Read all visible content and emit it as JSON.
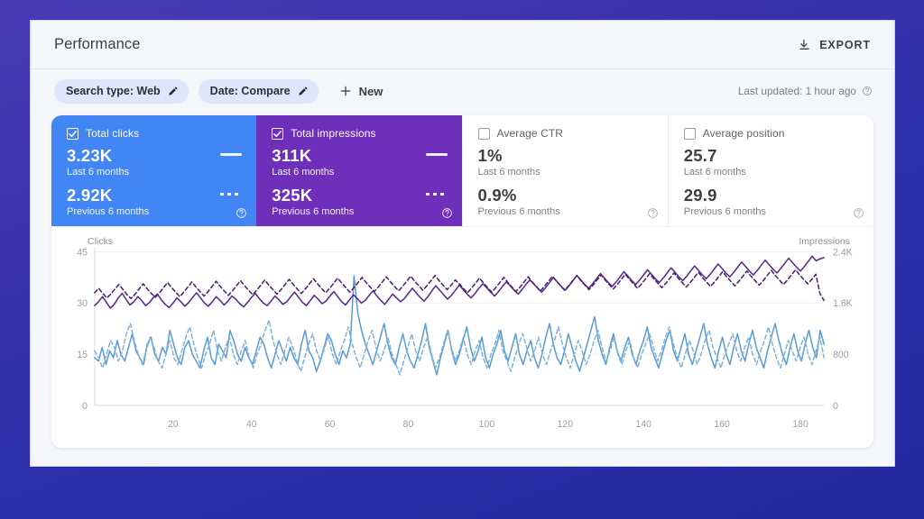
{
  "window": {
    "title": "Performance"
  },
  "topbar": {
    "title": "Performance",
    "export_label": "EXPORT",
    "export_icon": "download-icon"
  },
  "filterbar": {
    "chips": [
      {
        "label": "Search type: Web",
        "icon": "pencil-icon"
      },
      {
        "label": "Date: Compare",
        "icon": "pencil-icon"
      }
    ],
    "new_label": "New",
    "new_icon": "plus-icon",
    "last_updated": "Last updated: 1 hour ago",
    "help_icon": "help-circle-icon"
  },
  "metrics": [
    {
      "id": "total-clicks",
      "title": "Total clicks",
      "checked": true,
      "state": "active",
      "color": "#4285f4",
      "current_value": "3.23K",
      "current_period": "Last 6 months",
      "previous_value": "2.92K",
      "previous_period": "Previous 6 months",
      "current_mark": "solid",
      "previous_mark": "dashed",
      "help_icon": "help-circle-icon"
    },
    {
      "id": "total-impressions",
      "title": "Total impressions",
      "checked": true,
      "state": "active",
      "color": "#6e30ba",
      "current_value": "311K",
      "current_period": "Last 6 months",
      "previous_value": "325K",
      "previous_period": "Previous 6 months",
      "current_mark": "solid",
      "previous_mark": "dashed",
      "help_icon": "help-circle-icon"
    },
    {
      "id": "average-ctr",
      "title": "Average CTR",
      "checked": false,
      "state": "idle",
      "current_value": "1%",
      "current_period": "Last 6 months",
      "previous_value": "0.9%",
      "previous_period": "Previous 6 months",
      "help_icon": "help-circle-icon"
    },
    {
      "id": "average-position",
      "title": "Average position",
      "checked": false,
      "state": "idle",
      "current_value": "25.7",
      "current_period": "Last 6 months",
      "previous_value": "29.9",
      "previous_period": "Previous 6 months",
      "help_icon": "help-circle-icon"
    }
  ],
  "chart_data": {
    "type": "line",
    "title": "",
    "xlabel": "",
    "ylabel": "Clicks",
    "y2label": "Impressions",
    "grid": true,
    "legend_position": "metric-cards",
    "xlim": [
      0,
      186
    ],
    "xticks": [
      20,
      40,
      60,
      80,
      100,
      120,
      140,
      160,
      180
    ],
    "ylim": [
      0,
      45
    ],
    "yticks": [
      0,
      15,
      30,
      45
    ],
    "yticklabels": [
      "0",
      "15",
      "30",
      "45"
    ],
    "y2lim": [
      0,
      2400
    ],
    "y2ticks": [
      0,
      800,
      1600,
      2400
    ],
    "y2ticklabels": [
      "0",
      "800",
      "1.6K",
      "2.4K"
    ],
    "series": [
      {
        "name": "Total clicks — Last 6 months",
        "axis": "left",
        "style": "solid",
        "color": "#5b9bd5",
        "values": [
          14,
          13,
          17,
          12,
          16,
          14,
          19,
          15,
          13,
          17,
          21,
          16,
          14,
          12,
          18,
          20,
          15,
          13,
          17,
          15,
          22,
          18,
          14,
          12,
          17,
          19,
          15,
          13,
          11,
          16,
          20,
          14,
          12,
          18,
          16,
          14,
          22,
          19,
          15,
          13,
          17,
          14,
          12,
          16,
          20,
          18,
          14,
          11,
          15,
          19,
          16,
          13,
          17,
          14,
          12,
          18,
          22,
          16,
          14,
          10,
          13,
          17,
          21,
          19,
          15,
          12,
          16,
          14,
          18,
          38,
          27,
          22,
          18,
          15,
          12,
          16,
          20,
          24,
          18,
          14,
          12,
          17,
          21,
          16,
          13,
          11,
          15,
          19,
          24,
          17,
          13,
          9,
          14,
          18,
          22,
          16,
          12,
          15,
          19,
          23,
          17,
          13,
          16,
          20,
          14,
          11,
          15,
          18,
          22,
          16,
          13,
          17,
          21,
          15,
          12,
          16,
          19,
          14,
          11,
          15,
          20,
          24,
          18,
          14,
          12,
          16,
          21,
          17,
          13,
          10,
          14,
          18,
          22,
          26,
          19,
          15,
          12,
          17,
          21,
          16,
          13,
          17,
          20,
          15,
          12,
          16,
          19,
          23,
          17,
          14,
          11,
          15,
          19,
          22,
          16,
          13,
          17,
          21,
          15,
          12,
          16,
          20,
          24,
          18,
          14,
          11,
          16,
          20,
          15,
          12,
          17,
          21,
          16,
          13,
          18,
          22,
          17,
          14,
          11,
          16,
          20,
          24,
          19,
          15,
          12,
          17,
          21,
          16,
          13,
          18,
          22,
          17,
          14,
          22,
          18
        ]
      },
      {
        "name": "Total clicks — Previous 6 months",
        "axis": "left",
        "style": "dashed",
        "color": "#7fb2de",
        "values": [
          16,
          14,
          11,
          15,
          19,
          17,
          13,
          16,
          21,
          24,
          19,
          15,
          12,
          16,
          20,
          17,
          13,
          11,
          15,
          19,
          14,
          12,
          16,
          20,
          23,
          18,
          14,
          11,
          15,
          18,
          22,
          16,
          13,
          17,
          20,
          15,
          12,
          16,
          19,
          14,
          11,
          15,
          18,
          22,
          25,
          19,
          15,
          12,
          16,
          20,
          17,
          13,
          10,
          14,
          18,
          21,
          16,
          13,
          17,
          20,
          15,
          12,
          16,
          19,
          23,
          18,
          14,
          11,
          15,
          19,
          22,
          17,
          13,
          16,
          20,
          15,
          12,
          9,
          13,
          17,
          21,
          16,
          13,
          17,
          20,
          15,
          11,
          14,
          18,
          22,
          17,
          13,
          16,
          20,
          15,
          12,
          16,
          19,
          14,
          11,
          15,
          18,
          22,
          16,
          13,
          10,
          14,
          18,
          21,
          17,
          13,
          16,
          20,
          15,
          12,
          16,
          19,
          23,
          18,
          14,
          11,
          15,
          19,
          16,
          12,
          15,
          19,
          22,
          17,
          13,
          16,
          20,
          15,
          12,
          16,
          19,
          14,
          11,
          15,
          18,
          21,
          17,
          13,
          16,
          20,
          23,
          18,
          14,
          11,
          15,
          19,
          16,
          12,
          15,
          19,
          22,
          17,
          14,
          11,
          15,
          18,
          21,
          16,
          13,
          17,
          20,
          15,
          12,
          16,
          19,
          23,
          18,
          14,
          11,
          15,
          19,
          16,
          13,
          17,
          20,
          15,
          12,
          16,
          20,
          14
        ]
      },
      {
        "name": "Total impressions — Last 6 months",
        "axis": "right",
        "style": "solid",
        "color": "#5c2a8d",
        "values": [
          1560,
          1620,
          1700,
          1610,
          1520,
          1580,
          1680,
          1750,
          1660,
          1570,
          1620,
          1700,
          1640,
          1560,
          1610,
          1690,
          1740,
          1650,
          1580,
          1530,
          1600,
          1680,
          1620,
          1550,
          1610,
          1690,
          1760,
          1680,
          1600,
          1550,
          1620,
          1700,
          1640,
          1570,
          1630,
          1710,
          1660,
          1590,
          1540,
          1610,
          1690,
          1750,
          1670,
          1600,
          1560,
          1630,
          1710,
          1650,
          1580,
          1620,
          1700,
          1770,
          1690,
          1610,
          1560,
          1640,
          1720,
          1660,
          1590,
          1630,
          1710,
          1780,
          1700,
          1620,
          1570,
          1650,
          1730,
          1670,
          1600,
          1640,
          1720,
          1790,
          1710,
          1640,
          1580,
          1660,
          1740,
          1680,
          1620,
          1670,
          1750,
          1830,
          1760,
          1690,
          1630,
          1700,
          1790,
          1870,
          1800,
          1730,
          1660,
          1720,
          1800,
          1880,
          1810,
          1740,
          1680,
          1750,
          1830,
          1900,
          1840,
          1770,
          1710,
          1780,
          1860,
          1930,
          1870,
          1800,
          1740,
          1810,
          1890,
          1960,
          1900,
          1830,
          1770,
          1840,
          1920,
          2000,
          1930,
          1860,
          1800,
          1870,
          1950,
          2030,
          1960,
          1890,
          1830,
          1900,
          1980,
          2060,
          1990,
          1920,
          1860,
          1930,
          2010,
          2090,
          2020,
          1950,
          1890,
          1960,
          2040,
          2120,
          2050,
          1980,
          1920,
          1990,
          2070,
          2150,
          2080,
          2010,
          1950,
          2020,
          2100,
          2180,
          2110,
          2040,
          1980,
          2050,
          2130,
          2210,
          2140,
          2070,
          2010,
          2080,
          2160,
          2240,
          2170,
          2100,
          2040,
          2110,
          2190,
          2270,
          2200,
          2130,
          2070,
          2140,
          2220,
          2300,
          2230,
          2160,
          2100,
          2170,
          2250,
          2330,
          2260,
          2290,
          2310
        ]
      },
      {
        "name": "Total impressions — Previous 6 months",
        "axis": "right",
        "style": "dashed",
        "color": "#4a2270",
        "values": [
          1760,
          1830,
          1750,
          1680,
          1740,
          1820,
          1890,
          1810,
          1730,
          1670,
          1740,
          1820,
          1900,
          1820,
          1750,
          1690,
          1760,
          1840,
          1920,
          1840,
          1770,
          1700,
          1770,
          1850,
          1930,
          1850,
          1780,
          1710,
          1780,
          1860,
          1940,
          1860,
          1790,
          1720,
          1790,
          1870,
          1950,
          1870,
          1800,
          1730,
          1800,
          1880,
          1960,
          1880,
          1810,
          1740,
          1810,
          1890,
          1970,
          1890,
          1820,
          1750,
          1820,
          1900,
          1980,
          1900,
          1830,
          1760,
          1830,
          1910,
          1990,
          1910,
          1840,
          1770,
          1840,
          1920,
          2000,
          1920,
          1850,
          1780,
          1850,
          1930,
          2010,
          1930,
          1860,
          1790,
          1860,
          1940,
          2020,
          1940,
          1870,
          1800,
          1870,
          1950,
          2030,
          1950,
          1880,
          1810,
          1880,
          1960,
          1900,
          1830,
          1760,
          1830,
          1910,
          1990,
          1910,
          1840,
          1770,
          1840,
          1920,
          2000,
          1920,
          1850,
          1780,
          1850,
          1930,
          2010,
          1930,
          1860,
          1790,
          1860,
          1940,
          2020,
          1940,
          1870,
          1800,
          1870,
          1950,
          2030,
          1950,
          1880,
          1810,
          1880,
          1960,
          2040,
          1960,
          1890,
          1820,
          1890,
          1970,
          2050,
          1970,
          1900,
          1830,
          1900,
          1980,
          2060,
          1980,
          1910,
          1840,
          1910,
          1990,
          2070,
          1990,
          1920,
          1850,
          1920,
          2000,
          2080,
          2000,
          1930,
          1860,
          1930,
          2010,
          2090,
          2010,
          1940,
          1870,
          1940,
          2020,
          2100,
          2020,
          1950,
          1880,
          1950,
          2030,
          2110,
          2030,
          1960,
          1890,
          1960,
          2040,
          2120,
          2040,
          1970,
          1900,
          1970,
          2050,
          1750,
          1640
        ]
      }
    ]
  }
}
